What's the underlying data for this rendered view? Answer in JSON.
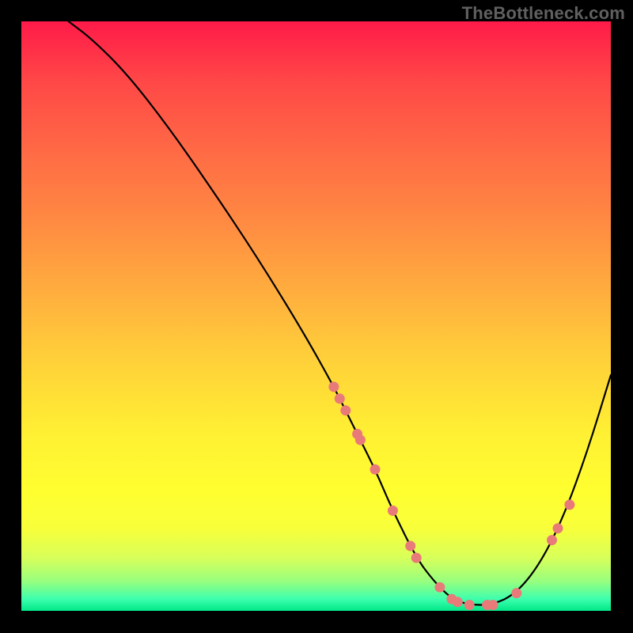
{
  "watermark": "TheBottleneck.com",
  "chart_data": {
    "type": "line",
    "title": "",
    "xlabel": "",
    "ylabel": "",
    "xlim": [
      0,
      100
    ],
    "ylim": [
      0,
      100
    ],
    "series": [
      {
        "name": "curve",
        "x": [
          8,
          12,
          18,
          25,
          32,
          40,
          48,
          53,
          55,
          57,
          60,
          63,
          67,
          70,
          73,
          76,
          80,
          84,
          88,
          92,
          96,
          100
        ],
        "y": [
          100,
          97,
          91,
          82,
          72,
          60,
          47,
          38,
          34,
          30,
          24,
          17,
          9,
          5,
          2,
          1,
          1,
          3,
          8,
          16,
          27,
          40
        ]
      }
    ],
    "markers": {
      "name": "highlight-dots",
      "color": "#e97a7a",
      "x": [
        53,
        54,
        55,
        57,
        57.5,
        60,
        63,
        66,
        67,
        71,
        73,
        74,
        76,
        79,
        80,
        84,
        90,
        91,
        93
      ],
      "y": [
        38,
        36,
        34,
        30,
        29,
        24,
        17,
        11,
        9,
        4,
        2,
        1.5,
        1,
        1,
        1,
        3,
        12,
        14,
        18
      ]
    }
  }
}
